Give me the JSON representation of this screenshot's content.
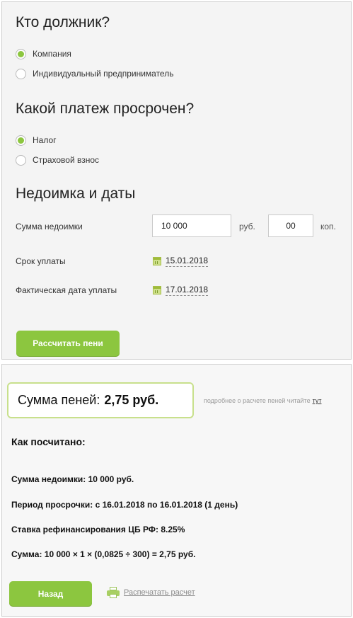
{
  "debtor": {
    "heading": "Кто должник?",
    "options": [
      {
        "label": "Компания",
        "selected": true
      },
      {
        "label": "Индивидуальный предприниматель",
        "selected": false
      }
    ]
  },
  "payment": {
    "heading": "Какой платеж просрочен?",
    "options": [
      {
        "label": "Налог",
        "selected": true
      },
      {
        "label": "Страховой взнос",
        "selected": false
      }
    ]
  },
  "arrears": {
    "heading": "Недоимка и даты",
    "amount_label": "Сумма недоимки",
    "rub_value": "10 000",
    "rub_unit": "руб.",
    "kop_value": "00",
    "kop_unit": "коп.",
    "due_label": "Срок уплаты",
    "due_date": "15.01.2018",
    "actual_label": "Фактическая дата уплаты",
    "actual_date": "17.01.2018",
    "calc_button": "Рассчитать пени"
  },
  "result": {
    "sum_label": "Сумма пеней:",
    "sum_value": "2,75 руб.",
    "more_text": "подробнее о расчете пеней читайте",
    "more_link": "тут",
    "how_title": "Как посчитано:",
    "lines": [
      "Сумма недоимки: 10 000 руб.",
      "Период просрочки: с 16.01.2018 по 16.01.2018 (1 день)",
      "Ставка рефинансирования ЦБ РФ: 8.25%",
      "Сумма: 10 000 × 1 × (0,0825 ÷ 300) = 2,75 руб."
    ],
    "back_button": "Назад",
    "print_link": "Распечатать расчет"
  },
  "colors": {
    "accent": "#8cc63f",
    "panel_bg": "#f4f4f4",
    "result_border": "#c8e08c"
  }
}
